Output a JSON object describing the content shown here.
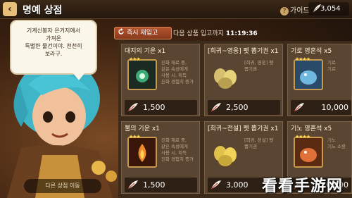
{
  "header": {
    "back_icon": "back-arrow-icon",
    "title": "명예 상점",
    "guide_label": "가이드",
    "currency_icon": "feather-icon",
    "currency_value": "3,054"
  },
  "speech": {
    "lines": [
      "기계신봉자 은거지에서",
      "가져온",
      "특별한 물건이야. 천천히",
      "보라구."
    ]
  },
  "shop": {
    "refresh_label": "즉시 재입고",
    "next_refresh_label": "다음 상품 입고까지",
    "next_refresh_time": "11:19:36"
  },
  "cards": [
    {
      "title": "대지의 기운 x1",
      "stars": "★★★",
      "desc": [
        "진화 재료 중,",
        "같은 속성에게",
        "사용 시, 획득",
        "진화 경험치 증가"
      ],
      "price": "1,500"
    },
    {
      "title": "[희귀~영웅] 펫 뽑기권 x1",
      "stars": "",
      "desc": [
        "[희귀, 영웅] 펫",
        "뽑기권"
      ],
      "price": "2,500"
    },
    {
      "title": "기로 영혼석 x5",
      "stars": "★★★★",
      "desc": [
        "기로",
        "기로"
      ],
      "price": "10,000"
    },
    {
      "title": "불의 기운 x1",
      "stars": "★★★",
      "desc": [
        "진화 재료 중,",
        "같은 속성에게",
        "사용 시, 획득",
        "진화 경험치 증가"
      ],
      "price": "1,500"
    },
    {
      "title": "[희귀~전설] 펫 뽑기권 x1",
      "stars": "",
      "desc": [
        "[희귀, 전설] 펫",
        "뽑기권"
      ],
      "price": "3,000"
    },
    {
      "title": "기노 영혼석 x5",
      "stars": "★★★★",
      "desc": [
        "기노",
        "기노 소환"
      ],
      "price": "10,000"
    }
  ],
  "footer": {
    "other_shop_label": "다른 상점 이동"
  },
  "watermark": "看看手游网",
  "colors": {
    "accent": "#b5542f",
    "panel": "#5a4532",
    "star": "#ffd84a"
  }
}
